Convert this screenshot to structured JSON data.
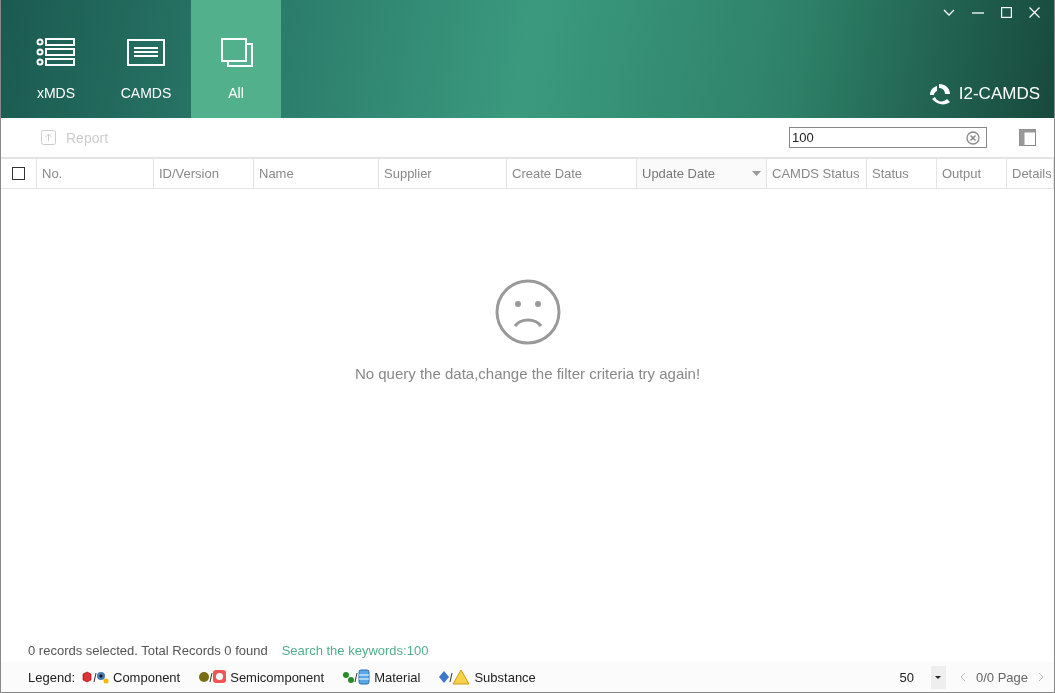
{
  "window": {
    "brand": "I2-CAMDS"
  },
  "nav_tabs": [
    {
      "label": "xMDS",
      "kind": "list",
      "selected": false
    },
    {
      "label": "CAMDS",
      "kind": "form",
      "selected": false
    },
    {
      "label": "All",
      "kind": "stack",
      "selected": true
    }
  ],
  "toolbar": {
    "report_button": {
      "label": "Report",
      "disabled": true
    },
    "search": {
      "value": "100"
    }
  },
  "table": {
    "select_all_checked": false,
    "columns": [
      {
        "label": "No.",
        "sorted": false
      },
      {
        "label": "ID/Version",
        "sorted": false
      },
      {
        "label": "Name",
        "sorted": false
      },
      {
        "label": "Supplier",
        "sorted": false
      },
      {
        "label": "Create Date",
        "sorted": false
      },
      {
        "label": "Update Date",
        "sorted": true
      },
      {
        "label": "CAMDS Status",
        "sorted": false
      },
      {
        "label": "Status",
        "sorted": false
      },
      {
        "label": "Output",
        "sorted": false
      },
      {
        "label": "Details",
        "sorted": false
      }
    ],
    "empty_message": "No query the data,change the filter criteria try again!"
  },
  "status": {
    "summary": "0 records selected. Total Records 0 found",
    "keywords": "Search the keywords:100"
  },
  "legend": {
    "label": "Legend:",
    "items": [
      {
        "kind": "component",
        "label": "Component"
      },
      {
        "kind": "semicomponent",
        "label": "Semicomponent"
      },
      {
        "kind": "material",
        "label": "Material"
      },
      {
        "kind": "substance",
        "label": "Substance"
      }
    ]
  },
  "pagination": {
    "page_size": "50",
    "page": "0/0 Page"
  }
}
